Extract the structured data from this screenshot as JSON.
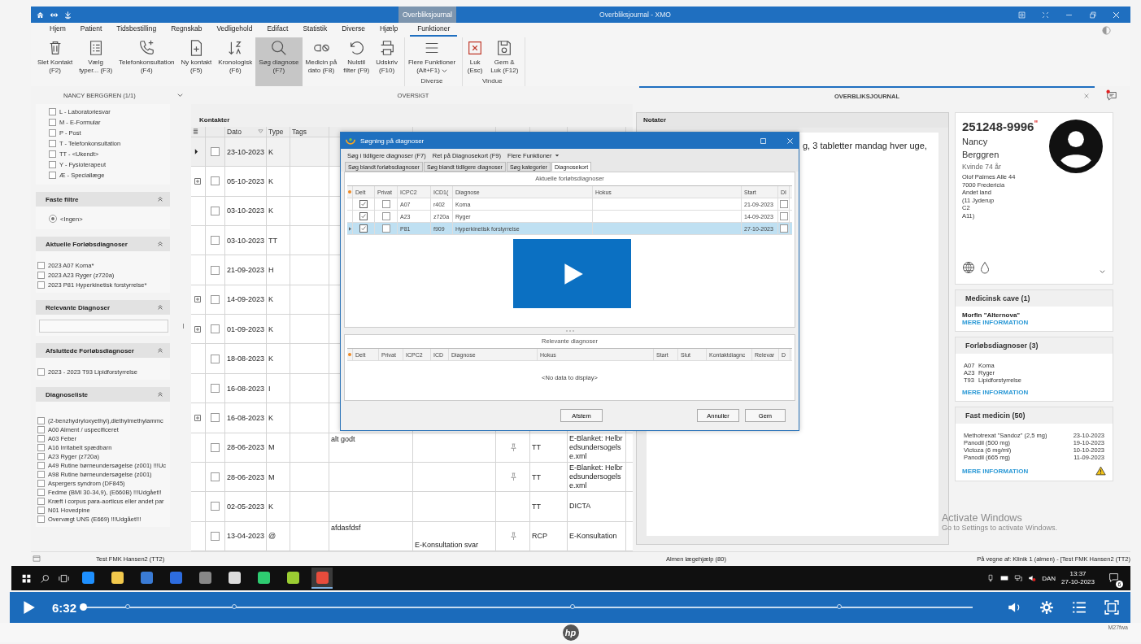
{
  "title_bar": {
    "context_tab": "Overbliksjournal",
    "title": "Overbliksjournal - XMO"
  },
  "menu_tabs": [
    {
      "label": "Hjem",
      "selected": false
    },
    {
      "label": "Patient",
      "selected": false
    },
    {
      "label": "Tidsbestilling",
      "selected": false
    },
    {
      "label": "Regnskab",
      "selected": false
    },
    {
      "label": "Vedligehold",
      "selected": false
    },
    {
      "label": "Edifact",
      "selected": false
    },
    {
      "label": "Statistik",
      "selected": false
    },
    {
      "label": "Diverse",
      "selected": false
    },
    {
      "label": "Hjælp",
      "selected": false
    },
    {
      "label": "Funktioner",
      "selected": true
    }
  ],
  "ribbon": {
    "groups": [
      {
        "buttons": [
          {
            "lines": [
              "Slet Kontakt",
              "(F2)"
            ],
            "selected": false
          },
          {
            "lines": [
              "Vælg",
              "typer... (F3)"
            ],
            "selected": false
          },
          {
            "lines": [
              "Telefonkonsultation",
              "(F4)"
            ],
            "selected": false
          },
          {
            "lines": [
              "Ny kontakt",
              "(F5)"
            ],
            "selected": false
          },
          {
            "lines": [
              "Kronologisk",
              "(F6)"
            ],
            "selected": false
          },
          {
            "lines": [
              "Søg diagnose",
              "(F7)"
            ],
            "selected": true
          },
          {
            "lines": [
              "Medicin på",
              "dato (F8)"
            ],
            "selected": false
          },
          {
            "lines": [
              "Nulstil",
              "filter (F9)"
            ],
            "selected": false
          },
          {
            "lines": [
              "Udskriv",
              "(F10)"
            ],
            "selected": false
          }
        ]
      },
      {
        "label": "Diverse",
        "buttons": [
          {
            "lines": [
              "Flere Funktioner",
              "(Alt+F1)"
            ],
            "selected": false
          }
        ]
      },
      {
        "label": "Vindue",
        "buttons": [
          {
            "lines": [
              "Luk",
              "(Esc)"
            ],
            "selected": false
          },
          {
            "lines": [
              "Gem &",
              "Luk (F12)"
            ],
            "selected": false
          }
        ]
      }
    ]
  },
  "doc_tabs": [
    {
      "label": "NANCY BERGGREN (1/1)",
      "selected": false
    },
    {
      "label": "OVERSIGT",
      "selected": false
    },
    {
      "label": "OVERBLIKSJOURNAL",
      "selected": true
    }
  ],
  "sidebar": {
    "type_filters": [
      {
        "label": "L - Laboratoriesvar",
        "checked": false
      },
      {
        "label": "M - E-Formular",
        "checked": false
      },
      {
        "label": "P - Post",
        "checked": false
      },
      {
        "label": "T - Telefonkonsultation",
        "checked": false
      },
      {
        "label": "TT - <Ukendt>",
        "checked": false
      },
      {
        "label": "Y - Fysioterapeut",
        "checked": false
      },
      {
        "label": "Æ - Speciallæge",
        "checked": false
      }
    ],
    "panels": [
      {
        "kind": "radio",
        "title": "Faste filtre",
        "items": [
          {
            "label": "<Ingen>",
            "selected": true
          }
        ]
      },
      {
        "kind": "checklist",
        "title": "Aktuelle Forløbsdiagnoser",
        "items": [
          {
            "label": "2023 A07 Koma*",
            "checked": false
          },
          {
            "label": "2023 A23 Ryger (z720a)",
            "checked": false
          },
          {
            "label": "2023 P81 Hyperkinetisk forstyrrelse*",
            "checked": false
          }
        ]
      },
      {
        "kind": "field",
        "title": "Relevante Diagnoser"
      },
      {
        "kind": "checklist",
        "title": "Afsluttede Forløbsdiagnoser",
        "items": [
          {
            "label": "2023 - 2023 T93 Lipidforstyrrelse",
            "checked": false
          }
        ]
      },
      {
        "kind": "checklist",
        "title": "Diagnoseliste",
        "items": [
          {
            "label": "(2-benzhydryloxyethyl),diethylmethylammc",
            "checked": false
          },
          {
            "label": "A00 Alment / uspecificeret",
            "checked": false
          },
          {
            "label": "A03 Feber",
            "checked": false
          },
          {
            "label": "A16 Irritabelt spædbarn",
            "checked": false
          },
          {
            "label": "A23 Ryger (z720a)",
            "checked": false
          },
          {
            "label": "A49 Rutine børneundersøgelse (z001) !!!Uc",
            "checked": false
          },
          {
            "label": "A98 Rutine børneundersøgelse (z001)",
            "checked": false
          },
          {
            "label": "Aspergers syndrom (DF845)",
            "checked": false
          },
          {
            "label": "Fedme (BMI 30-34,9), (E660B) !!!Udgået!!",
            "checked": false
          },
          {
            "label": "Kræft i corpus para-aorticus eller andet par",
            "checked": false
          },
          {
            "label": "N01 Hovedpine",
            "checked": false
          },
          {
            "label": "Overvægt UNS (E669) !!!Udgået!!!",
            "checked": false
          }
        ]
      }
    ]
  },
  "contacts": {
    "title": "Kontakter",
    "columns": [
      "Dato",
      "Type",
      "Tags"
    ],
    "rows": [
      {
        "current": true,
        "expandable": false,
        "checked": false,
        "date": "23-10-2023",
        "type": "K"
      },
      {
        "current": false,
        "expandable": true,
        "checked": false,
        "date": "05-10-2023",
        "type": "K"
      },
      {
        "current": false,
        "expandable": false,
        "checked": false,
        "date": "03-10-2023",
        "type": "K"
      },
      {
        "current": false,
        "expandable": false,
        "checked": false,
        "date": "03-10-2023",
        "type": "TT"
      },
      {
        "current": false,
        "expandable": false,
        "checked": false,
        "date": "21-09-2023",
        "type": "H"
      },
      {
        "current": false,
        "expandable": true,
        "checked": false,
        "date": "14-09-2023",
        "type": "K"
      },
      {
        "current": false,
        "expandable": true,
        "checked": false,
        "date": "01-09-2023",
        "type": "K"
      },
      {
        "current": false,
        "expandable": false,
        "checked": false,
        "date": "18-08-2023",
        "type": "K"
      },
      {
        "current": false,
        "expandable": false,
        "checked": false,
        "date": "16-08-2023",
        "type": "I"
      },
      {
        "current": false,
        "expandable": true,
        "checked": false,
        "date": "16-08-2023",
        "type": "K"
      },
      {
        "current": false,
        "expandable": false,
        "checked": false,
        "date": "28-06-2023",
        "type": "M",
        "content": "alt godt",
        "pinned": true,
        "handler": "TT",
        "heading": "E-Blanket: Helbredsundersogelse.xml"
      },
      {
        "current": false,
        "expandable": false,
        "checked": false,
        "date": "28-06-2023",
        "type": "M",
        "pinned": true,
        "handler": "TT",
        "heading": "E-Blanket: Helbredsundersogelse.xml"
      },
      {
        "current": false,
        "expandable": false,
        "checked": false,
        "date": "02-05-2023",
        "type": "K",
        "pinned": false,
        "handler": "TT",
        "heading": "DICTA"
      },
      {
        "current": false,
        "expandable": false,
        "checked": false,
        "date": "13-04-2023",
        "type": "@",
        "content": "afdasfdsf",
        "column_5": "E-Konsultation svar",
        "pinned": true,
        "handler": "RCP",
        "heading": "E-Konsultation"
      }
    ]
  },
  "dialog": {
    "title": "Søgning på diagnoser",
    "menu": [
      "Søg i tidligere diagnoser (F7)",
      "Ret på Diagnosekort (F9)",
      "Flere Funktioner"
    ],
    "tabs": [
      {
        "label": "Søg blandt forløbsdiagnoser",
        "selected": false
      },
      {
        "label": "Søg blandt tidligere diagnoser",
        "selected": false
      },
      {
        "label": "Søg kategorier",
        "selected": false
      },
      {
        "label": "Diagnosekort",
        "selected": true
      }
    ],
    "current": {
      "title": "Aktuelle forløbsdiagnoser",
      "columns": [
        "Delt",
        "Privat",
        "ICPC2",
        "ICD1(",
        "Diagnose",
        "Hokus",
        "Start",
        "DI"
      ],
      "rows": [
        {
          "selected": false,
          "shared": true,
          "private": false,
          "icpc2": "A07",
          "icd": "r402",
          "diagnosis": "Koma",
          "start": "21-09-2023",
          "flag": false
        },
        {
          "selected": false,
          "shared": true,
          "private": false,
          "icpc2": "A23",
          "icd": "z720a",
          "diagnosis": "Ryger",
          "start": "14-09-2023",
          "flag": false
        },
        {
          "selected": true,
          "shared": true,
          "private": false,
          "icpc2": "P81",
          "icd": "f909",
          "diagnosis": "Hyperkinetisk forstyrrelse",
          "start": "27-10-2023",
          "flag": false
        }
      ]
    },
    "relevant": {
      "title": "Relevante diagnoser",
      "columns": [
        "Delt",
        "Privat",
        "ICPC2",
        "ICD",
        "Diagnose",
        "Hokus",
        "Start",
        "Slut",
        "Kontaktdiagnc",
        "Relevar",
        "D"
      ],
      "empty_text": "<No data to display>"
    },
    "buttons": [
      "Afstem",
      "Annuller",
      "Gem"
    ]
  },
  "notes": {
    "title": "Notater",
    "text": "g, 3 tabletter mandag hver uge,"
  },
  "patient": {
    "cpr": "251248-9996",
    "cpr_mark": "\"",
    "first_name": "Nancy",
    "last_name": "Berggren",
    "gender_age": "Kvinde 74 år",
    "address": [
      "Olof Palmes Alle 44",
      "7000 Fredericia",
      "Andet land",
      "(11 Jyderup",
      "C2",
      "A11)"
    ]
  },
  "cave": {
    "title": "Medicinsk cave (1)",
    "items": [
      "Morfin \"Alternova\""
    ],
    "link": "MERE INFORMATION"
  },
  "course_diagnoses": {
    "title": "Forløbsdiagnoser (3)",
    "rows": [
      {
        "code": "A07",
        "name": "Koma"
      },
      {
        "code": "A23",
        "name": "Ryger"
      },
      {
        "code": "T93",
        "name": "Lipidforstyrrelse"
      }
    ],
    "link": "MERE INFORMATION"
  },
  "fixed_medicine": {
    "title": "Fast medicin (50)",
    "rows": [
      {
        "name": "Methotrexat \"Sandoz\" (2,5 mg)",
        "date": "23-10-2023"
      },
      {
        "name": "Panodil (500 mg)",
        "date": "19-10-2023"
      },
      {
        "name": "Victoza (6 mg/ml)",
        "date": "10-10-2023"
      },
      {
        "name": "Panodil (665 mg)",
        "date": "11-09-2023"
      }
    ],
    "link": "MERE INFORMATION"
  },
  "activation_notice": [
    "Activate Windows",
    "Go to Settings to activate Windows."
  ],
  "status_bar": [
    "Test FMK Hansen2 (TT2)",
    "Almen lægehjælp (80)",
    "På vegne af: Klinik 1 (almen) - [Test FMK Hansen2 (TT2)"
  ],
  "taskbar": {
    "language": "DAN",
    "time": "13:37",
    "date": "27-10-2023",
    "notification_count": "6"
  },
  "player": {
    "time": "6:32",
    "level": 0
  },
  "monitor": {
    "logo": "hp",
    "model": "M27fwa"
  }
}
